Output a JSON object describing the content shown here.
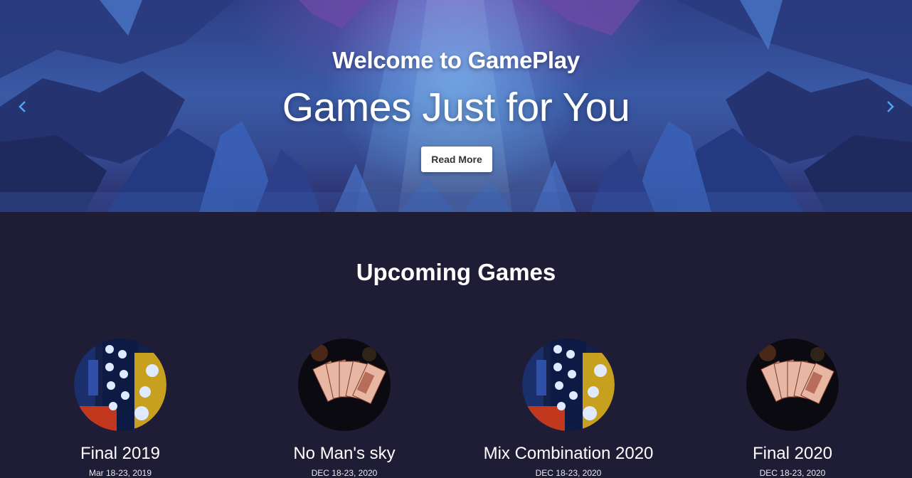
{
  "hero": {
    "subtitle": "Welcome to GamePlay",
    "title": "Games Just for You",
    "cta_label": "Read More",
    "prev_arrow": "‹",
    "next_arrow": "›"
  },
  "upcoming": {
    "heading": "Upcoming Games",
    "games": [
      {
        "name": "Final 2019",
        "date": "Mar 18-23, 2019",
        "image": "casino-chips-image"
      },
      {
        "name": "No Man's sky",
        "date": "DEC 18-23, 2020",
        "image": "playing-cards-image"
      },
      {
        "name": "Mix Combination 2020",
        "date": "DEC 18-23, 2020",
        "image": "casino-chips-image"
      },
      {
        "name": "Final 2020",
        "date": "DEC 18-23, 2020",
        "image": "playing-cards-image"
      }
    ]
  },
  "colors": {
    "page_background": "#1f1c35",
    "arrow_blue": "#4fa3f3",
    "hero_blue": "#3a5aa6"
  }
}
